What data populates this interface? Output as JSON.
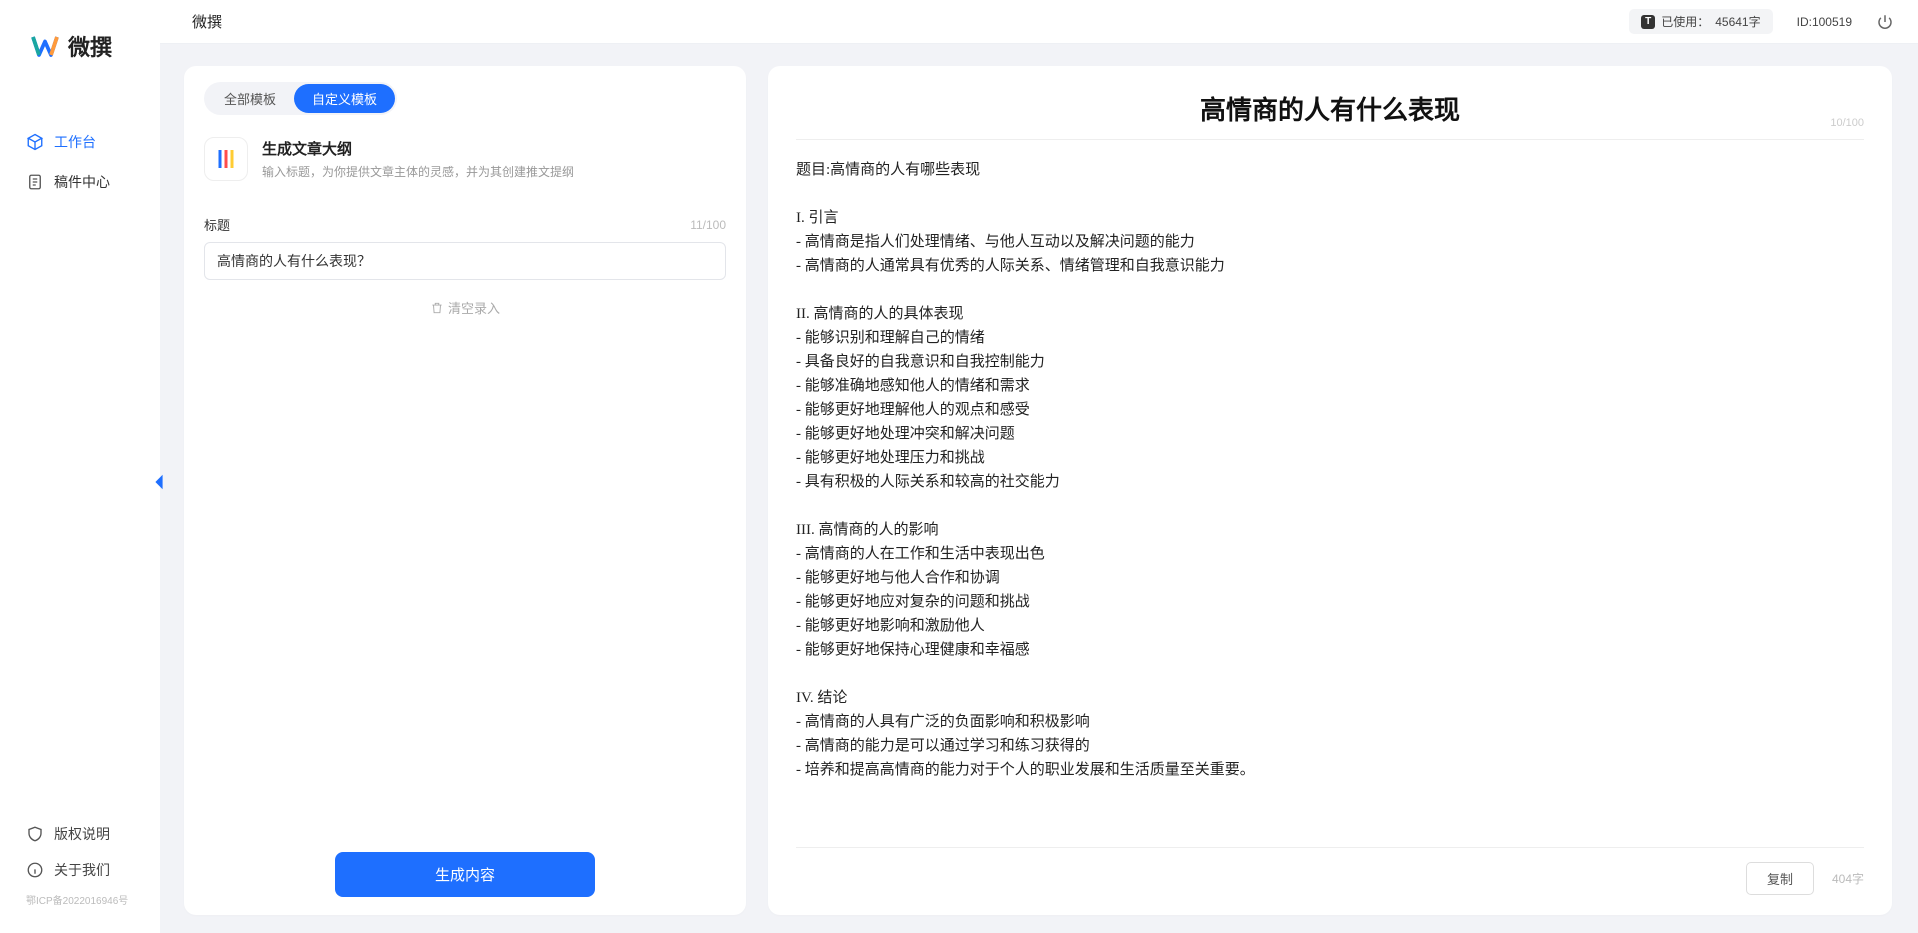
{
  "app": {
    "name": "微撰",
    "logo_colors": {
      "blue": "#1e6fff",
      "teal": "#1aa7a0",
      "orange": "#ff9a3b"
    }
  },
  "sidebar": {
    "items": [
      {
        "label": "工作台",
        "icon": "cube"
      },
      {
        "label": "稿件中心",
        "icon": "doc"
      }
    ],
    "bottom": [
      {
        "label": "版权说明",
        "icon": "shield"
      },
      {
        "label": "关于我们",
        "icon": "info"
      }
    ],
    "icp": "鄂ICP备2022016946号"
  },
  "topbar": {
    "title": "微撰",
    "usage_prefix": "已使用：",
    "usage_value": "45641字",
    "user_id_label": "ID:100519"
  },
  "left_panel": {
    "tabs": [
      {
        "label": "全部模板",
        "active": false
      },
      {
        "label": "自定义模板",
        "active": true
      }
    ],
    "template": {
      "title": "生成文章大纲",
      "desc": "输入标题，为你提供文章主体的灵感，并为其创建推文提纲"
    },
    "title_field": {
      "label": "标题",
      "counter": "11/100",
      "value": "高情商的人有什么表现？"
    },
    "clear_label": "清空录入",
    "generate_label": "生成内容"
  },
  "right_panel": {
    "output_title": "高情商的人有什么表现",
    "title_counter": "10/100",
    "body": "题目:高情商的人有哪些表现\n\nI. 引言\n- 高情商是指人们处理情绪、与他人互动以及解决问题的能力\n- 高情商的人通常具有优秀的人际关系、情绪管理和自我意识能力\n\nII. 高情商的人的具体表现\n- 能够识别和理解自己的情绪\n- 具备良好的自我意识和自我控制能力\n- 能够准确地感知他人的情绪和需求\n- 能够更好地理解他人的观点和感受\n- 能够更好地处理冲突和解决问题\n- 能够更好地处理压力和挑战\n- 具有积极的人际关系和较高的社交能力\n\nIII. 高情商的人的影响\n- 高情商的人在工作和生活中表现出色\n- 能够更好地与他人合作和协调\n- 能够更好地应对复杂的问题和挑战\n- 能够更好地影响和激励他人\n- 能够更好地保持心理健康和幸福感\n\nIV. 结论\n- 高情商的人具有广泛的负面影响和积极影响\n- 高情商的能力是可以通过学习和练习获得的\n- 培养和提高高情商的能力对于个人的职业发展和生活质量至关重要。",
    "copy_label": "复制",
    "char_count": "404字"
  }
}
